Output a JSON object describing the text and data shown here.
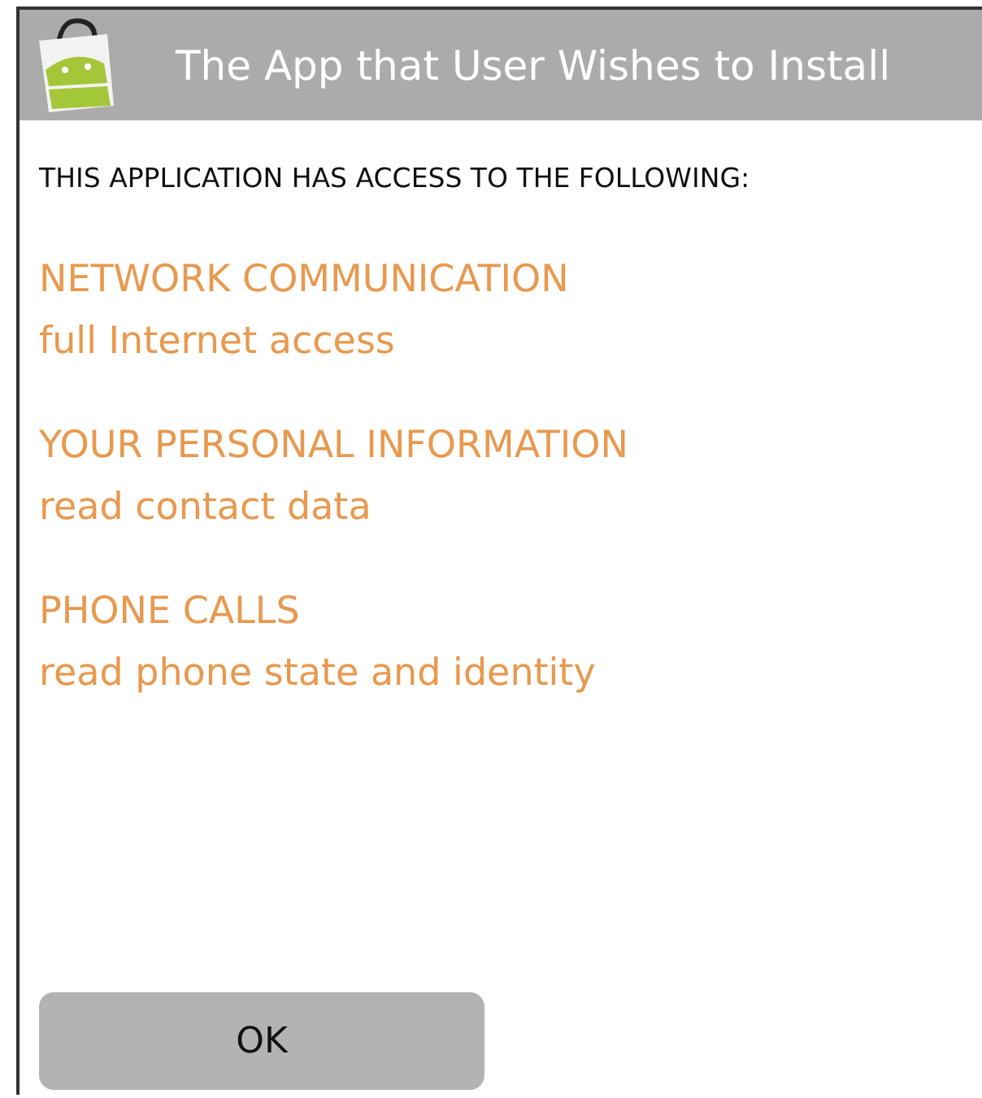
{
  "dialog": {
    "title": "The App that User Wishes to Install",
    "heading": "THIS APPLICATION HAS ACCESS TO THE FOLLOWING:",
    "permissions": [
      {
        "group": "NETWORK COMMUNICATION",
        "detail": "full Internet access"
      },
      {
        "group": "YOUR PERSONAL INFORMATION",
        "detail": "read contact data"
      },
      {
        "group": "PHONE CALLS",
        "detail": "read phone state and identity"
      }
    ],
    "buttons": [
      "OK"
    ]
  }
}
